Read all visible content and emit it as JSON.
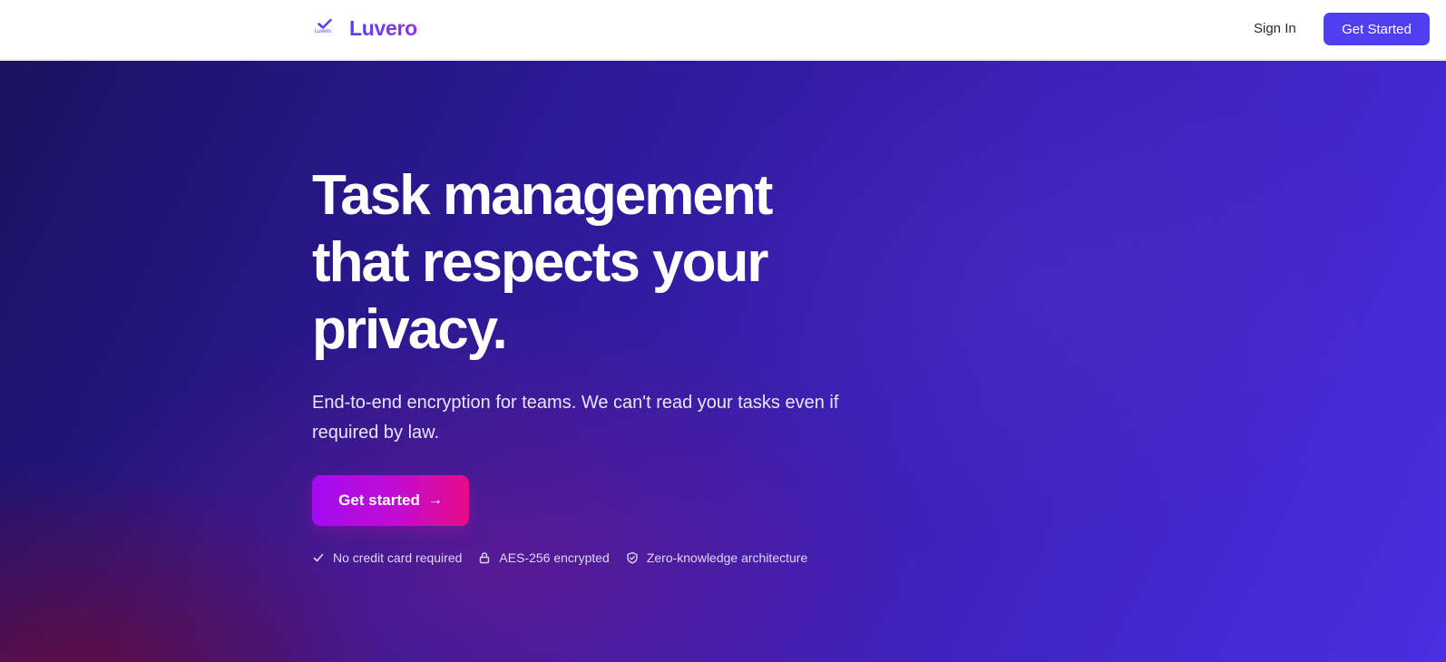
{
  "header": {
    "brand_name": "Luvero",
    "brand_logo_text": "Luvero",
    "sign_in": "Sign In",
    "get_started": "Get Started"
  },
  "hero": {
    "title": "Task management that respects your privacy.",
    "subtitle": "End-to-end encryption for teams. We can't read your tasks even if required by law.",
    "cta_label": "Get started",
    "cta_arrow": "→",
    "badges": [
      {
        "icon": "check-icon",
        "label": "No credit card required"
      },
      {
        "icon": "lock-icon",
        "label": "AES-256 encrypted"
      },
      {
        "icon": "shield-icon",
        "label": "Zero-knowledge architecture"
      }
    ]
  },
  "colors": {
    "brand": "#5b3df5",
    "button_primary": "#4f3ff0",
    "cta_gradient_start": "#a30bf2",
    "cta_gradient_end": "#e90b86",
    "hero_background": "#2a1890"
  }
}
